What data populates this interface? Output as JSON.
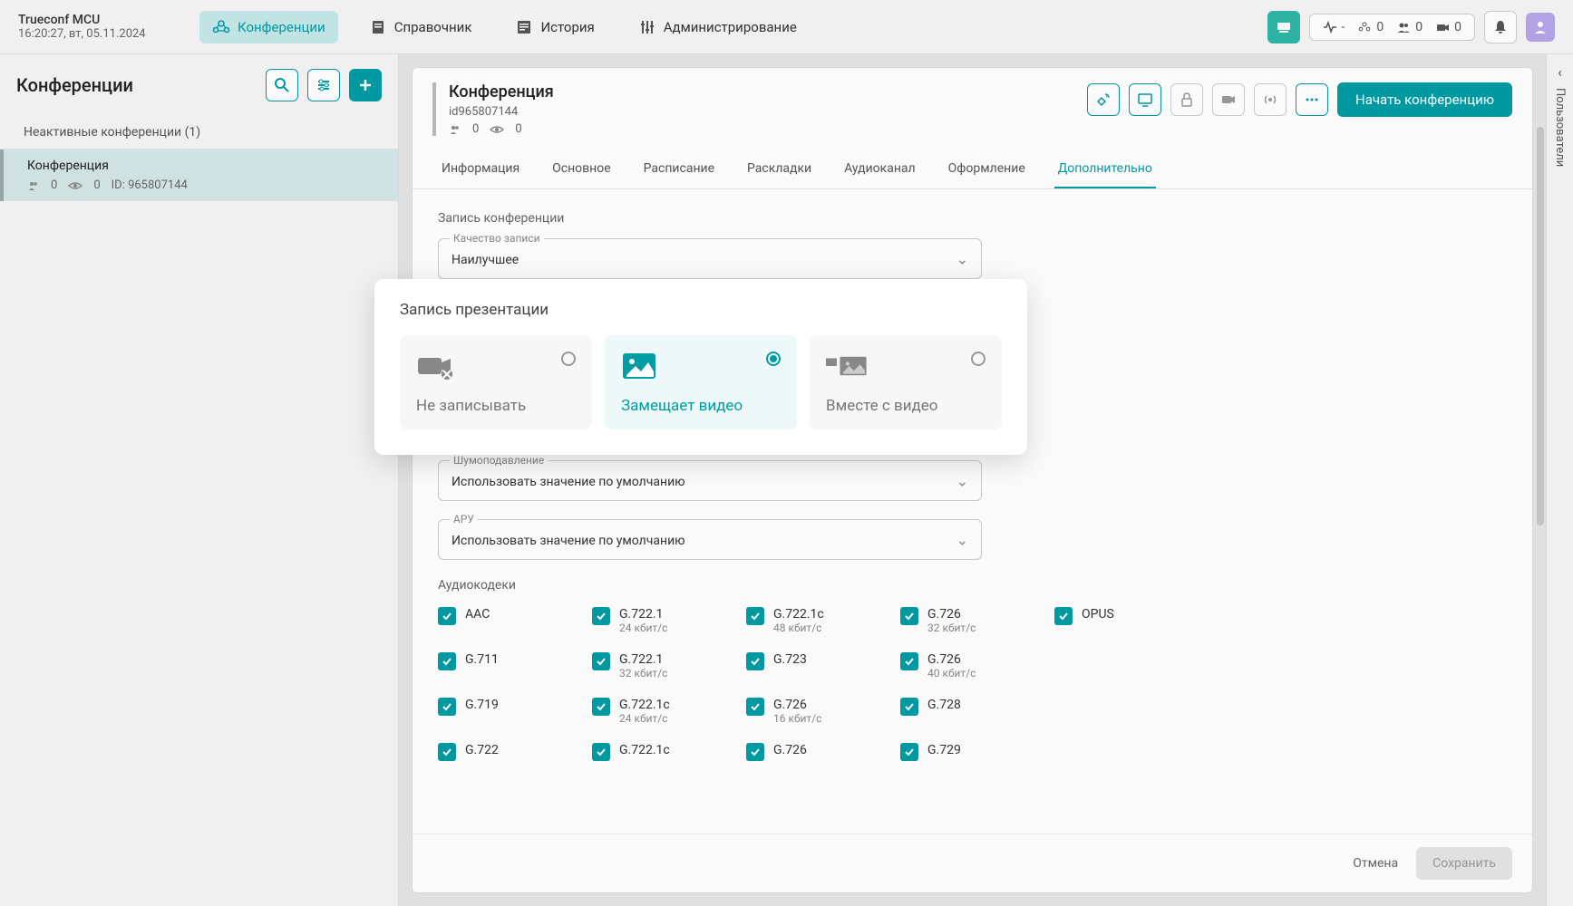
{
  "brand": {
    "name": "Trueconf MCU",
    "time": "16:20:27, вт, 05.11.2024"
  },
  "nav": {
    "conferences": "Конференции",
    "directory": "Справочник",
    "history": "История",
    "admin": "Администрирование"
  },
  "topstats": {
    "pulse": "-",
    "a": "0",
    "b": "0",
    "c": "0"
  },
  "sidebar": {
    "title": "Конференции",
    "group": "Неактивные конференции (1)",
    "item": {
      "title": "Конференция",
      "p": "0",
      "v": "0",
      "id_label": "ID: 965807144"
    }
  },
  "panel": {
    "title": "Конференция",
    "id": "id965807144",
    "p": "0",
    "v": "0",
    "start": "Начать конференцию"
  },
  "tabs": {
    "info": "Информация",
    "main": "Основное",
    "schedule": "Расписание",
    "layouts": "Раскладки",
    "audio": "Аудиоканал",
    "design": "Оформление",
    "extra": "Дополнительно"
  },
  "rec": {
    "section": "Запись конференции",
    "quality_label": "Качество записи",
    "quality_value": "Наилучшее"
  },
  "audio_settings": {
    "noise_label": "Шумоподавление",
    "noise_value": "Использовать значение по умолчанию",
    "aru_label": "АРУ",
    "aru_value": "Использовать значение по умолчанию",
    "codecs_label": "Аудиокодеки"
  },
  "codecs": [
    [
      "AAC",
      ""
    ],
    [
      "G.722.1",
      "24 кбит/с"
    ],
    [
      "G.722.1c",
      "48 кбит/с"
    ],
    [
      "G.726",
      "32 кбит/с"
    ],
    [
      "OPUS",
      ""
    ],
    [
      "G.711",
      ""
    ],
    [
      "G.722.1",
      "32 кбит/с"
    ],
    [
      "G.723",
      ""
    ],
    [
      "G.726",
      "40 кбит/с"
    ],
    [
      "",
      ""
    ],
    [
      "G.719",
      ""
    ],
    [
      "G.722.1c",
      "24 кбит/с"
    ],
    [
      "G.726",
      "16 кбит/с"
    ],
    [
      "G.728",
      ""
    ],
    [
      "",
      ""
    ],
    [
      "G.722",
      ""
    ],
    [
      "G.722.1c",
      ""
    ],
    [
      "G.726",
      ""
    ],
    [
      "G.729",
      ""
    ],
    [
      "",
      ""
    ]
  ],
  "footer": {
    "cancel": "Отмена",
    "save": "Сохранить"
  },
  "rail": {
    "label": "Пользователи"
  },
  "modal": {
    "title": "Запись презентации",
    "opt1": "Не записывать",
    "opt2": "Замещает видео",
    "opt3": "Вместе с видео"
  }
}
